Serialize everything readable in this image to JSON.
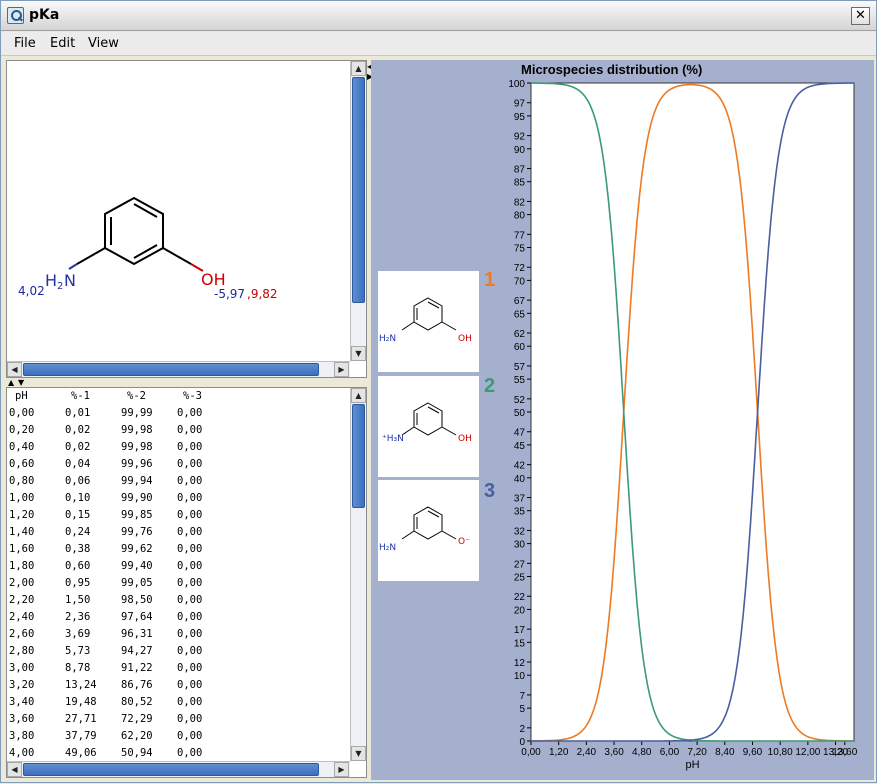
{
  "window": {
    "title": "pKa",
    "close_label": "✕"
  },
  "menu": {
    "items": [
      "File",
      "Edit",
      "View"
    ]
  },
  "molecule": {
    "amine_pka": "4,02",
    "amine_label": "H",
    "amine_sub": "2",
    "amine_N": "N",
    "hydroxyl_label": "OH",
    "hydroxyl_pka_1": "-5,97",
    "hydroxyl_pka_2": ",9,82"
  },
  "table": {
    "headers": [
      "pH",
      "%-1",
      "%-2",
      "%-3"
    ],
    "rows": [
      [
        "0,00",
        "0,01",
        "99,99",
        "0,00"
      ],
      [
        "0,20",
        "0,02",
        "99,98",
        "0,00"
      ],
      [
        "0,40",
        "0,02",
        "99,98",
        "0,00"
      ],
      [
        "0,60",
        "0,04",
        "99,96",
        "0,00"
      ],
      [
        "0,80",
        "0,06",
        "99,94",
        "0,00"
      ],
      [
        "1,00",
        "0,10",
        "99,90",
        "0,00"
      ],
      [
        "1,20",
        "0,15",
        "99,85",
        "0,00"
      ],
      [
        "1,40",
        "0,24",
        "99,76",
        "0,00"
      ],
      [
        "1,60",
        "0,38",
        "99,62",
        "0,00"
      ],
      [
        "1,80",
        "0,60",
        "99,40",
        "0,00"
      ],
      [
        "2,00",
        "0,95",
        "99,05",
        "0,00"
      ],
      [
        "2,20",
        "1,50",
        "98,50",
        "0,00"
      ],
      [
        "2,40",
        "2,36",
        "97,64",
        "0,00"
      ],
      [
        "2,60",
        "3,69",
        "96,31",
        "0,00"
      ],
      [
        "2,80",
        "5,73",
        "94,27",
        "0,00"
      ],
      [
        "3,00",
        "8,78",
        "91,22",
        "0,00"
      ],
      [
        "3,20",
        "13,24",
        "86,76",
        "0,00"
      ],
      [
        "3,40",
        "19,48",
        "80,52",
        "0,00"
      ],
      [
        "3,60",
        "27,71",
        "72,29",
        "0,00"
      ],
      [
        "3,80",
        "37,79",
        "62,20",
        "0,00"
      ],
      [
        "4,00",
        "49,06",
        "50,94",
        "0,00"
      ]
    ]
  },
  "species": [
    {
      "number": "1",
      "color": "#ee7a22",
      "amine": "H₂N",
      "oxygen": "OH"
    },
    {
      "number": "2",
      "color": "#3c9a74",
      "amine": "⁺H₃N",
      "oxygen": "OH"
    },
    {
      "number": "3",
      "color": "#4a5fa0",
      "amine": "H₂N",
      "oxygen": "O⁻"
    }
  ],
  "chart_data": {
    "type": "line",
    "title": "Microspecies distribution (%)",
    "xlabel": "pH",
    "ylabel": "",
    "xlim": [
      0,
      14
    ],
    "ylim": [
      0,
      100
    ],
    "x_ticks": [
      "0,00",
      "1,20",
      "2,40",
      "3,60",
      "4,80",
      "6,00",
      "7,20",
      "8,40",
      "9,60",
      "10,80",
      "12,00",
      "13,20",
      "13,60"
    ],
    "y_ticks": [
      0,
      2,
      5,
      7,
      10,
      12,
      15,
      17,
      20,
      22,
      25,
      27,
      30,
      32,
      35,
      37,
      40,
      42,
      45,
      47,
      50,
      52,
      55,
      57,
      60,
      62,
      65,
      67,
      70,
      72,
      75,
      77,
      80,
      82,
      85,
      87,
      90,
      92,
      95,
      97,
      100
    ],
    "pka_values": [
      4.02,
      9.82
    ],
    "series": [
      {
        "name": "1",
        "color": "#ee7a22",
        "x": [
          0,
          1,
          2,
          3,
          3.6,
          4,
          4.4,
          5,
          6,
          7,
          8,
          9,
          9.4,
          9.82,
          10.2,
          11,
          12,
          13,
          14
        ],
        "values": [
          0.01,
          0.1,
          0.95,
          8.78,
          27.71,
          49.06,
          70.6,
          91.3,
          99.1,
          99.8,
          99.3,
          87.1,
          72.4,
          50,
          29.4,
          6.2,
          0.65,
          0.07,
          0.01
        ]
      },
      {
        "name": "2",
        "color": "#3c9a74",
        "x": [
          0,
          1,
          2,
          3,
          3.6,
          4,
          4.4,
          5,
          6,
          7,
          8,
          9,
          10,
          11,
          12,
          13,
          14
        ],
        "values": [
          99.99,
          99.9,
          99.05,
          91.22,
          72.29,
          50.94,
          29.4,
          8.7,
          0.9,
          0.09,
          0.01,
          0,
          0,
          0,
          0,
          0,
          0
        ]
      },
      {
        "name": "3",
        "color": "#4a5fa0",
        "x": [
          0,
          6,
          7,
          8,
          9,
          9.4,
          9.82,
          10.2,
          11,
          12,
          13,
          14
        ],
        "values": [
          0,
          0,
          0.15,
          0.7,
          12.9,
          27.6,
          50,
          70.6,
          93.8,
          99.35,
          99.93,
          99.99
        ]
      }
    ]
  }
}
